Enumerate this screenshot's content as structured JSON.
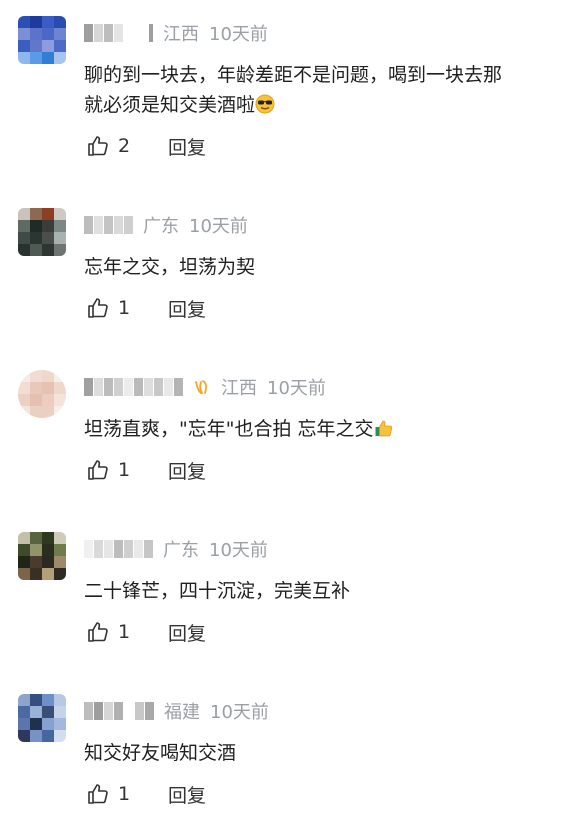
{
  "comments": [
    {
      "location": "江西",
      "time": "10天前",
      "text_lines": [
        "聊的到一块去，年龄差距不是问题，喝到一块去那",
        "就必须是知交美酒啦"
      ],
      "emoji": "sunglasses-emoji",
      "likes": "2",
      "reply_label": "回复"
    },
    {
      "location": "广东",
      "time": "10天前",
      "text_lines": [
        "忘年之交，坦荡为契"
      ],
      "likes": "1",
      "reply_label": "回复"
    },
    {
      "location": "江西",
      "time": "10天前",
      "text_lines": [
        "坦荡直爽，\"忘年\"也合拍 忘年之交"
      ],
      "emoji": "thumbs-up-emoji",
      "badge": "vip-badge-icon",
      "likes": "1",
      "reply_label": "回复"
    },
    {
      "location": "广东",
      "time": "10天前",
      "text_lines": [
        "二十锋芒，四十沉淀，完美互补"
      ],
      "likes": "1",
      "reply_label": "回复"
    },
    {
      "location": "福建",
      "time": "10天前",
      "text_lines": [
        "知交好友喝知交酒"
      ],
      "likes": "1",
      "reply_label": "回复"
    }
  ],
  "colors": {
    "meta": "#9aa0a6",
    "text": "#1f1f1f",
    "badge": "#f5a623"
  }
}
